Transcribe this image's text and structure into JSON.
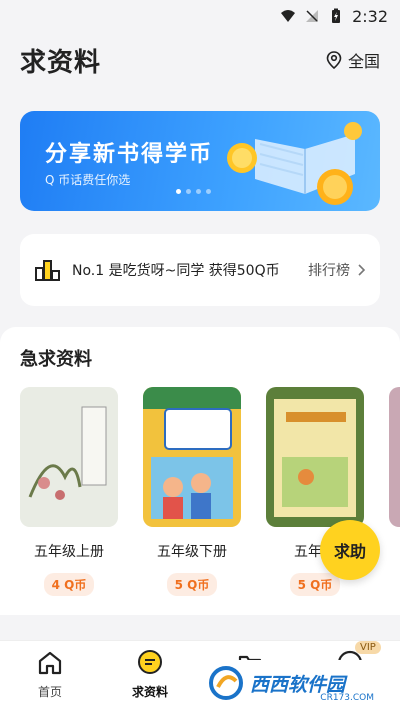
{
  "status_bar": {
    "time": "2:32"
  },
  "header": {
    "title": "求资料",
    "region": "全国"
  },
  "banner": {
    "title": "分享新书得学币",
    "subtitle": "Q 币话费任你选",
    "slides": 4,
    "active_slide": 0
  },
  "rank": {
    "text": "No.1 是吃货呀~同学 获得50Q币",
    "link_label": "排行榜"
  },
  "urgent": {
    "title": "急求资料",
    "books": [
      {
        "name": "五年级上册",
        "price": "4 Q币"
      },
      {
        "name": "五年级下册",
        "price": "5 Q币"
      },
      {
        "name": "五年级",
        "price": "5 Q币"
      }
    ]
  },
  "fab_label": "求助",
  "tabbar": {
    "tabs": [
      {
        "label": "首页",
        "icon": "home-icon"
      },
      {
        "label": "求资料",
        "icon": "chat-icon"
      },
      {
        "label": "",
        "icon": "folder-icon"
      },
      {
        "label": "",
        "icon": "profile-icon"
      }
    ],
    "vip_badge": "VIP"
  },
  "watermark": {
    "text": "西西软件园",
    "sub": "CR173.COM"
  },
  "colors": {
    "accent_blue": "#2f8ef8",
    "accent_yellow": "#ffd21f",
    "price_orange": "#f0701f"
  }
}
